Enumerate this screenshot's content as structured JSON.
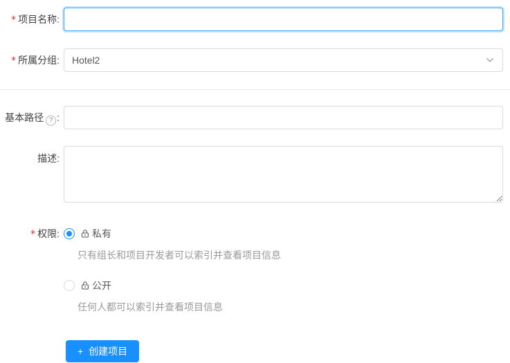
{
  "colors": {
    "accent": "#1890ff",
    "focus_border": "#40a9ff",
    "required": "#f5222d",
    "input_border": "#d9d9d9",
    "muted_text": "#999999"
  },
  "form": {
    "required_marker": "*",
    "project_name": {
      "label": "项目名称:",
      "value": "",
      "focused": true
    },
    "group": {
      "label": "所属分组:",
      "value": "Hotel2"
    },
    "base_path": {
      "label": "基本路径",
      "colon": ":",
      "help_glyph": "?",
      "value": ""
    },
    "description": {
      "label": "描述:",
      "value": ""
    },
    "permission": {
      "label": "权限:",
      "options": [
        {
          "label": "私有",
          "icon": "lock-icon",
          "selected": true,
          "description": "只有组长和项目开发者可以索引并查看项目信息"
        },
        {
          "label": "公开",
          "icon": "unlock-icon",
          "selected": false,
          "description": "任何人都可以索引并查看项目信息"
        }
      ]
    },
    "submit": {
      "plus_glyph": "+",
      "label": "创建项目"
    }
  }
}
